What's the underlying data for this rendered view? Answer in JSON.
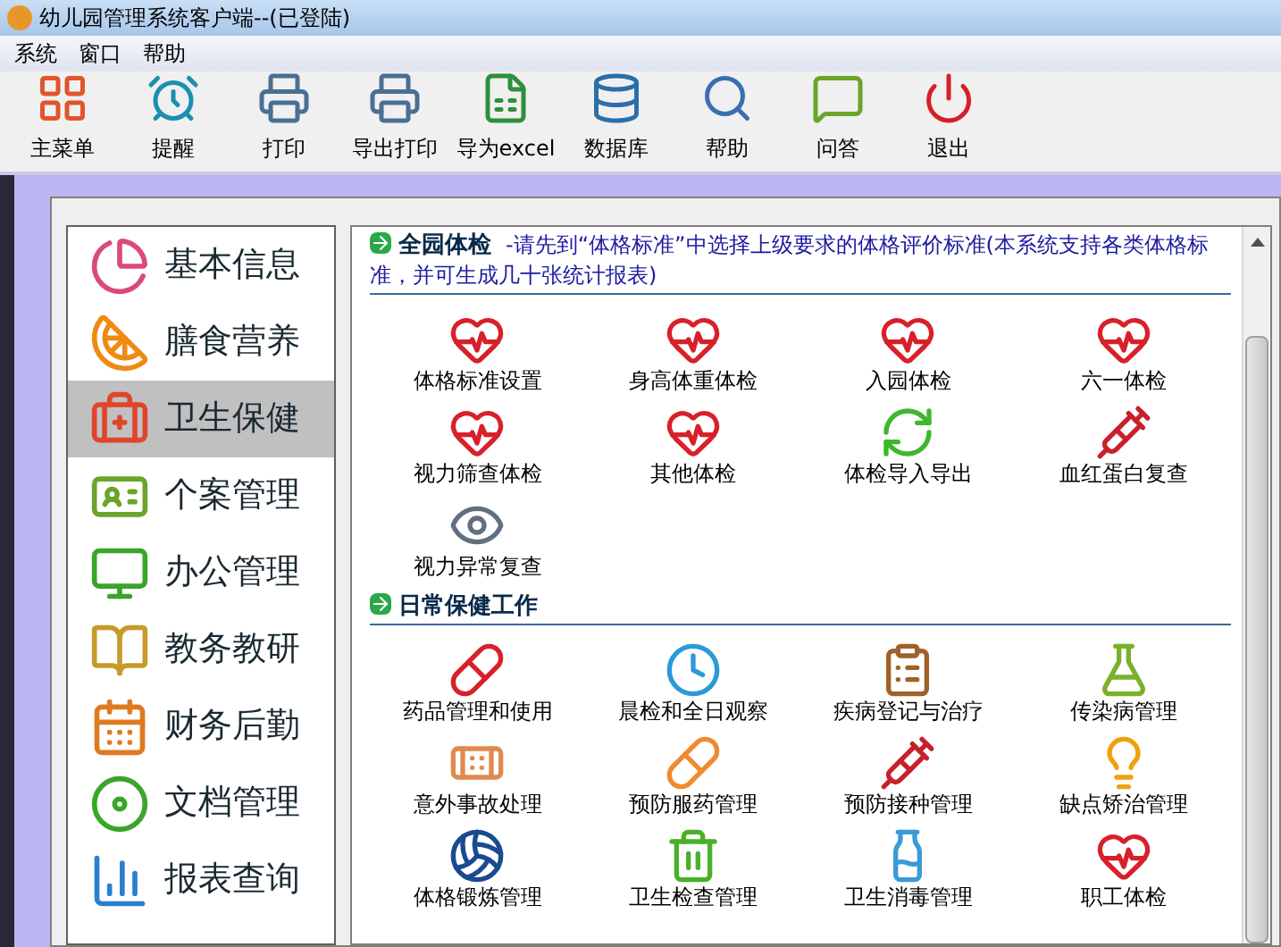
{
  "window": {
    "title": "幼儿园管理系统客户端--(已登陆)"
  },
  "menu": [
    "系统",
    "窗口",
    "帮助"
  ],
  "toolbar": [
    "主菜单",
    "提醒",
    "打印",
    "导出打印",
    "导为excel",
    "数据库",
    "帮助",
    "问答",
    "退出"
  ],
  "sidebar": {
    "items": [
      {
        "label": "基本信息",
        "selected": false
      },
      {
        "label": "膳食营养",
        "selected": false
      },
      {
        "label": "卫生保健",
        "selected": true
      },
      {
        "label": "个案管理",
        "selected": false
      },
      {
        "label": "办公管理",
        "selected": false
      },
      {
        "label": "教务教研",
        "selected": false
      },
      {
        "label": "财务后勤",
        "selected": false
      },
      {
        "label": "文档管理",
        "selected": false
      },
      {
        "label": "报表查询",
        "selected": false
      }
    ]
  },
  "sections": [
    {
      "title": "全园体检",
      "note": "-请先到“体格标准”中选择上级要求的体格评价标准(本系统支持各类体格标准，并可生成几十张统计报表)",
      "items": [
        "体格标准设置",
        "身高体重体检",
        "入园体检",
        "六一体检",
        "视力筛查体检",
        "其他体检",
        "体检导入导出",
        "血红蛋白复查",
        "视力异常复查"
      ]
    },
    {
      "title": "日常保健工作",
      "items": [
        "药品管理和使用",
        "晨检和全日观察",
        "疾病登记与治疗",
        "传染病管理",
        "意外事故处理",
        "预防服药管理",
        "预防接种管理",
        "缺点矫治管理",
        "体格锻炼管理",
        "卫生检查管理",
        "卫生消毒管理",
        "职工体检"
      ]
    }
  ]
}
